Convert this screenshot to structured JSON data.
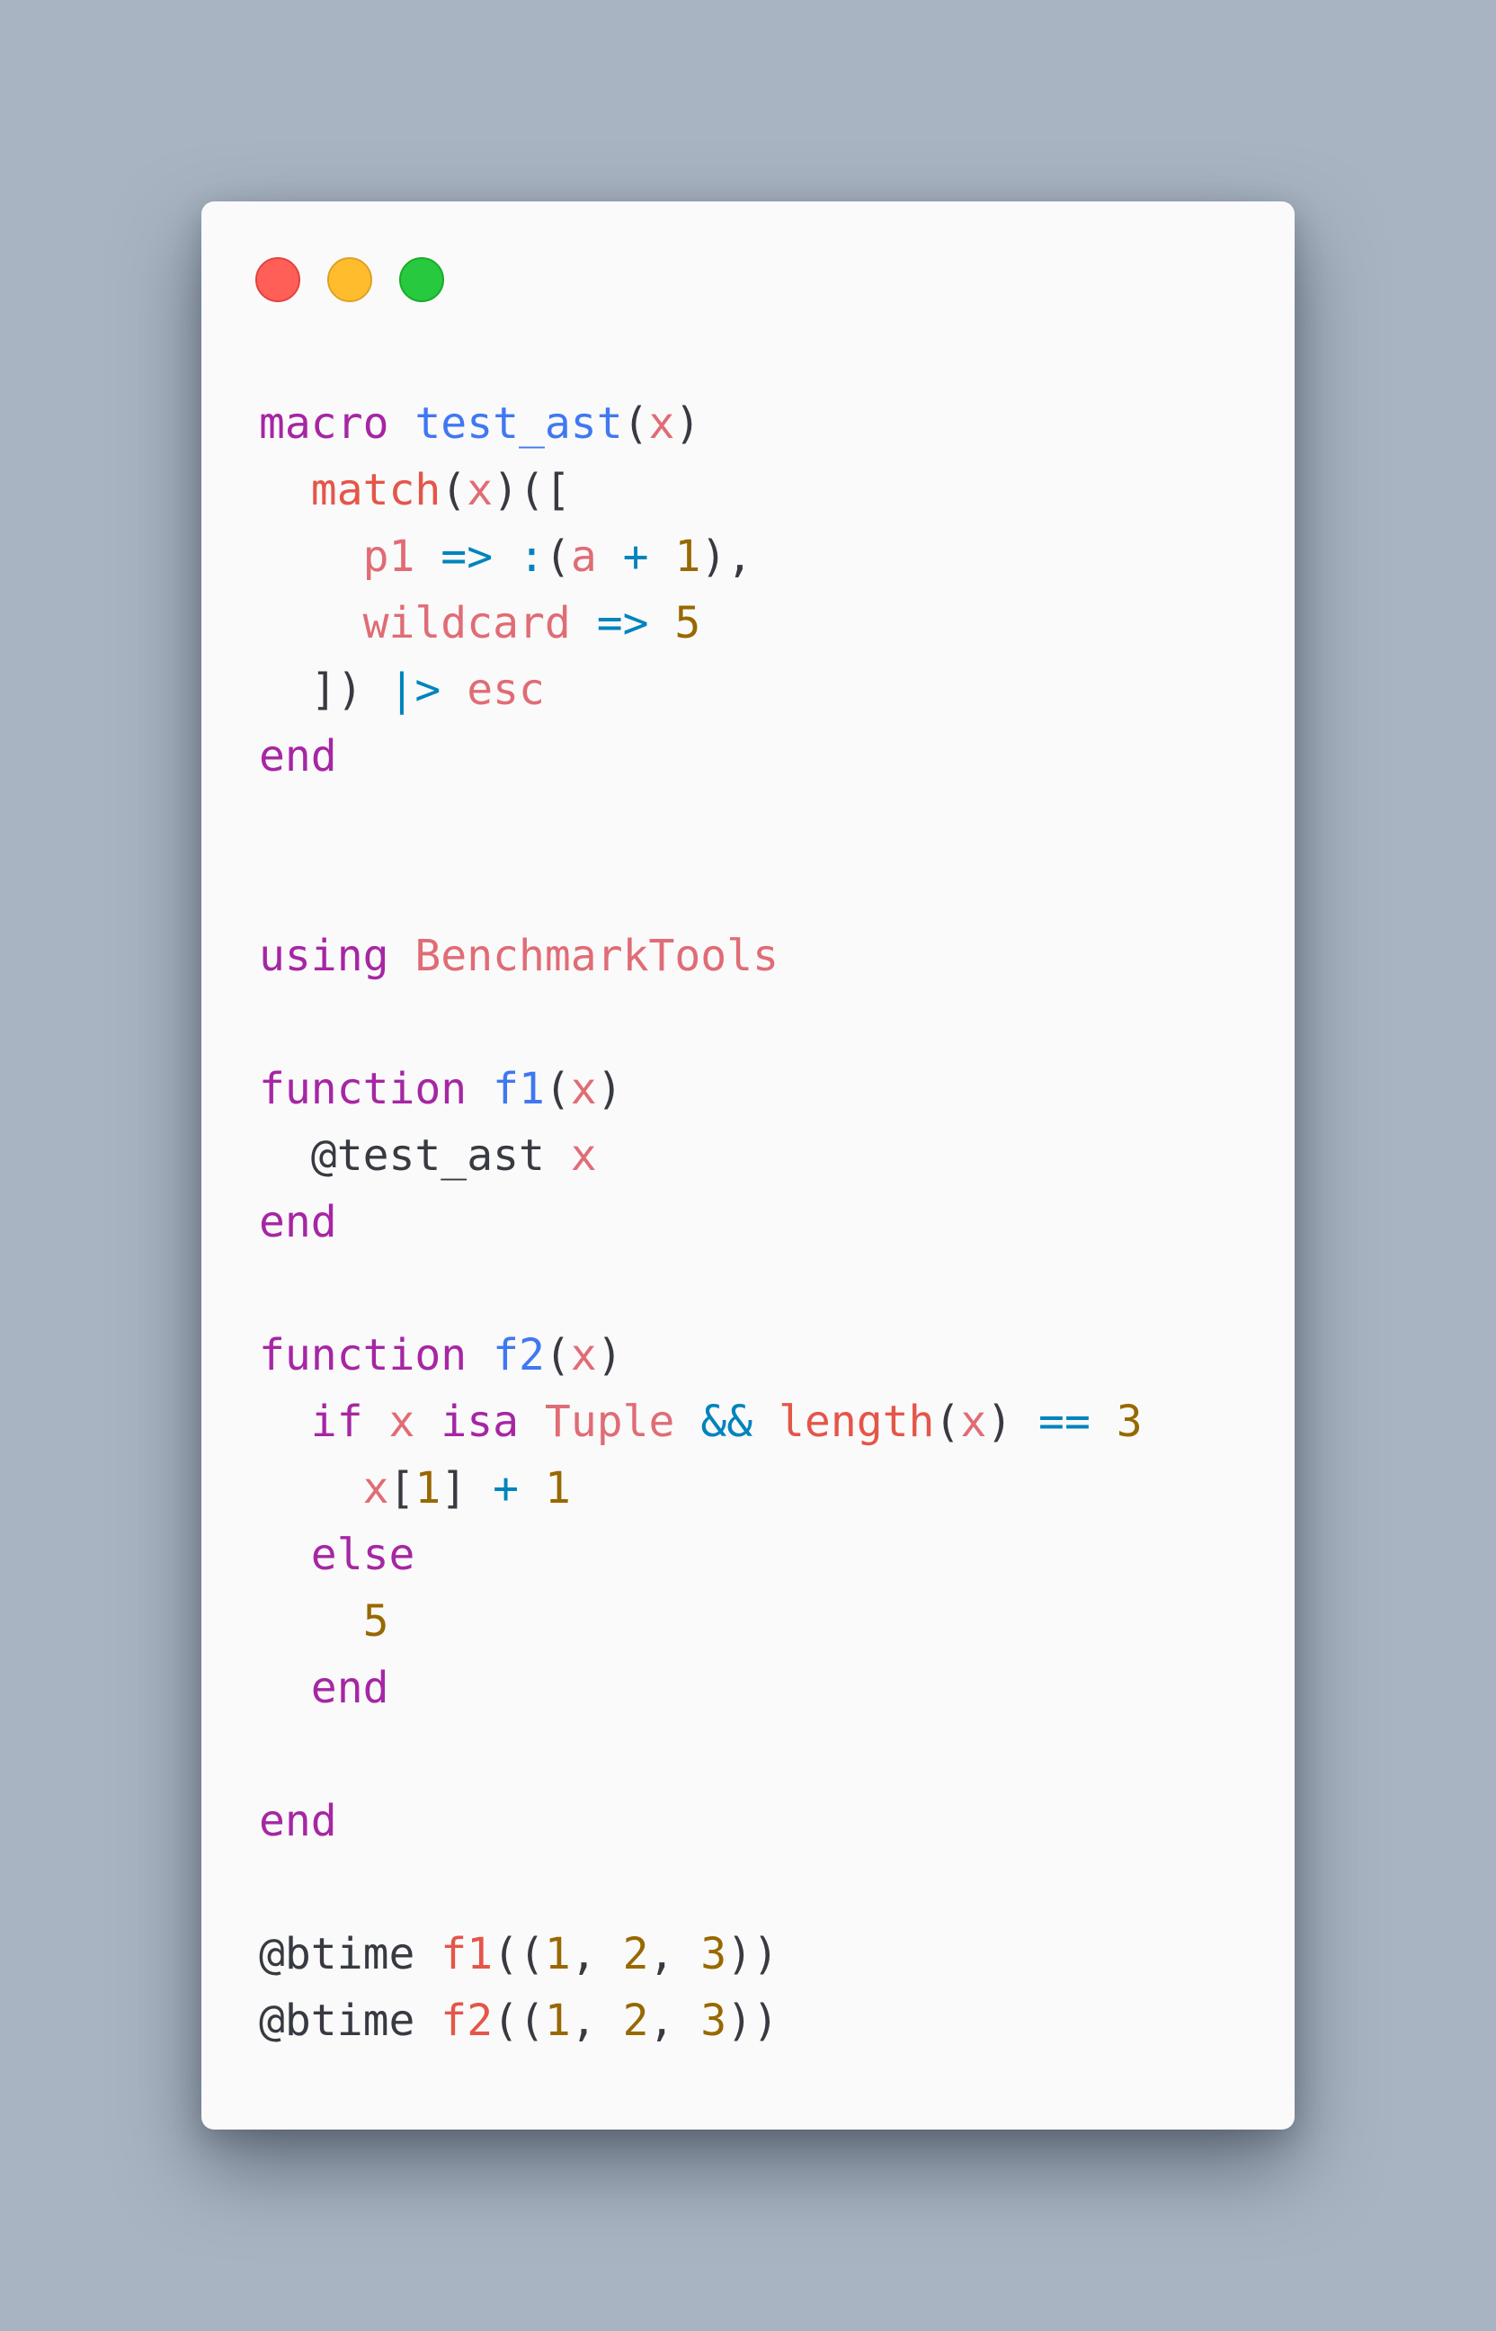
{
  "window": {
    "controls": [
      {
        "name": "close-control",
        "color": "#ff5f56",
        "border": "#e0443e"
      },
      {
        "name": "minimize-control",
        "color": "#ffbd2e",
        "border": "#dea123"
      },
      {
        "name": "zoom-control",
        "color": "#27c93f",
        "border": "#1aab29"
      }
    ]
  },
  "palette": {
    "keyword": "#a626a4",
    "function": "#4078f2",
    "variable": "#e45649",
    "builtin": "#e06c75",
    "number": "#986801",
    "operator": "#0184bc",
    "plain": "#383a42"
  },
  "code_lines": [
    [
      {
        "t": "macro",
        "c": "keyword"
      },
      {
        "t": " ",
        "c": "plain"
      },
      {
        "t": "test_ast",
        "c": "function"
      },
      {
        "t": "(",
        "c": "plain"
      },
      {
        "t": "x",
        "c": "builtin"
      },
      {
        "t": ")",
        "c": "plain"
      }
    ],
    [
      {
        "t": "  ",
        "c": "plain"
      },
      {
        "t": "match",
        "c": "variable"
      },
      {
        "t": "(",
        "c": "plain"
      },
      {
        "t": "x",
        "c": "builtin"
      },
      {
        "t": ")([",
        "c": "plain"
      }
    ],
    [
      {
        "t": "    ",
        "c": "plain"
      },
      {
        "t": "p1",
        "c": "builtin"
      },
      {
        "t": " ",
        "c": "plain"
      },
      {
        "t": "=>",
        "c": "operator"
      },
      {
        "t": " ",
        "c": "plain"
      },
      {
        "t": ":",
        "c": "operator"
      },
      {
        "t": "(",
        "c": "plain"
      },
      {
        "t": "a",
        "c": "builtin"
      },
      {
        "t": " ",
        "c": "plain"
      },
      {
        "t": "+",
        "c": "operator"
      },
      {
        "t": " ",
        "c": "plain"
      },
      {
        "t": "1",
        "c": "number"
      },
      {
        "t": "),",
        "c": "plain"
      }
    ],
    [
      {
        "t": "    ",
        "c": "plain"
      },
      {
        "t": "wildcard",
        "c": "builtin"
      },
      {
        "t": " ",
        "c": "plain"
      },
      {
        "t": "=>",
        "c": "operator"
      },
      {
        "t": " ",
        "c": "plain"
      },
      {
        "t": "5",
        "c": "number"
      }
    ],
    [
      {
        "t": "  ",
        "c": "plain"
      },
      {
        "t": "])",
        "c": "plain"
      },
      {
        "t": " ",
        "c": "plain"
      },
      {
        "t": "|>",
        "c": "operator"
      },
      {
        "t": " ",
        "c": "plain"
      },
      {
        "t": "esc",
        "c": "builtin"
      }
    ],
    [
      {
        "t": "end",
        "c": "keyword"
      }
    ],
    [],
    [],
    [
      {
        "t": "using",
        "c": "keyword"
      },
      {
        "t": " ",
        "c": "plain"
      },
      {
        "t": "BenchmarkTools",
        "c": "builtin"
      }
    ],
    [],
    [
      {
        "t": "function",
        "c": "keyword"
      },
      {
        "t": " ",
        "c": "plain"
      },
      {
        "t": "f1",
        "c": "function"
      },
      {
        "t": "(",
        "c": "plain"
      },
      {
        "t": "x",
        "c": "builtin"
      },
      {
        "t": ")",
        "c": "plain"
      }
    ],
    [
      {
        "t": "  ",
        "c": "plain"
      },
      {
        "t": "@test_ast",
        "c": "plain"
      },
      {
        "t": " ",
        "c": "plain"
      },
      {
        "t": "x",
        "c": "builtin"
      }
    ],
    [
      {
        "t": "end",
        "c": "keyword"
      }
    ],
    [],
    [
      {
        "t": "function",
        "c": "keyword"
      },
      {
        "t": " ",
        "c": "plain"
      },
      {
        "t": "f2",
        "c": "function"
      },
      {
        "t": "(",
        "c": "plain"
      },
      {
        "t": "x",
        "c": "builtin"
      },
      {
        "t": ")",
        "c": "plain"
      }
    ],
    [
      {
        "t": "  ",
        "c": "plain"
      },
      {
        "t": "if",
        "c": "keyword"
      },
      {
        "t": " ",
        "c": "plain"
      },
      {
        "t": "x",
        "c": "builtin"
      },
      {
        "t": " ",
        "c": "plain"
      },
      {
        "t": "isa",
        "c": "keyword"
      },
      {
        "t": " ",
        "c": "plain"
      },
      {
        "t": "Tuple",
        "c": "builtin"
      },
      {
        "t": " ",
        "c": "plain"
      },
      {
        "t": "&&",
        "c": "operator"
      },
      {
        "t": " ",
        "c": "plain"
      },
      {
        "t": "length",
        "c": "variable"
      },
      {
        "t": "(",
        "c": "plain"
      },
      {
        "t": "x",
        "c": "builtin"
      },
      {
        "t": ")",
        "c": "plain"
      },
      {
        "t": " ",
        "c": "plain"
      },
      {
        "t": "==",
        "c": "operator"
      },
      {
        "t": " ",
        "c": "plain"
      },
      {
        "t": "3",
        "c": "number"
      }
    ],
    [
      {
        "t": "    ",
        "c": "plain"
      },
      {
        "t": "x",
        "c": "builtin"
      },
      {
        "t": "[",
        "c": "plain"
      },
      {
        "t": "1",
        "c": "number"
      },
      {
        "t": "]",
        "c": "plain"
      },
      {
        "t": " ",
        "c": "plain"
      },
      {
        "t": "+",
        "c": "operator"
      },
      {
        "t": " ",
        "c": "plain"
      },
      {
        "t": "1",
        "c": "number"
      }
    ],
    [
      {
        "t": "  ",
        "c": "plain"
      },
      {
        "t": "else",
        "c": "keyword"
      }
    ],
    [
      {
        "t": "    ",
        "c": "plain"
      },
      {
        "t": "5",
        "c": "number"
      }
    ],
    [
      {
        "t": "  ",
        "c": "plain"
      },
      {
        "t": "end",
        "c": "keyword"
      }
    ],
    [],
    [
      {
        "t": "end",
        "c": "keyword"
      }
    ],
    [],
    [
      {
        "t": "@btime",
        "c": "plain"
      },
      {
        "t": " ",
        "c": "plain"
      },
      {
        "t": "f1",
        "c": "variable"
      },
      {
        "t": "((",
        "c": "plain"
      },
      {
        "t": "1",
        "c": "number"
      },
      {
        "t": ", ",
        "c": "plain"
      },
      {
        "t": "2",
        "c": "number"
      },
      {
        "t": ", ",
        "c": "plain"
      },
      {
        "t": "3",
        "c": "number"
      },
      {
        "t": "))",
        "c": "plain"
      }
    ],
    [
      {
        "t": "@btime",
        "c": "plain"
      },
      {
        "t": " ",
        "c": "plain"
      },
      {
        "t": "f2",
        "c": "variable"
      },
      {
        "t": "((",
        "c": "plain"
      },
      {
        "t": "1",
        "c": "number"
      },
      {
        "t": ", ",
        "c": "plain"
      },
      {
        "t": "2",
        "c": "number"
      },
      {
        "t": ", ",
        "c": "plain"
      },
      {
        "t": "3",
        "c": "number"
      },
      {
        "t": "))",
        "c": "plain"
      }
    ]
  ]
}
